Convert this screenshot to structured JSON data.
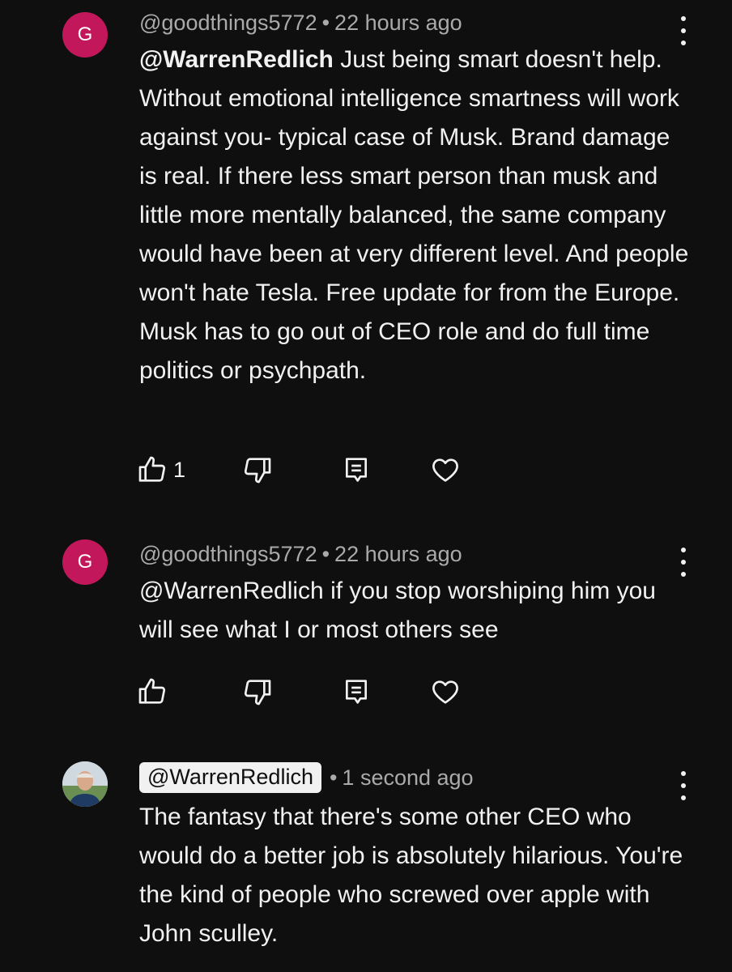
{
  "comments": [
    {
      "avatar_letter": "G",
      "author": "@goodthings5772",
      "separator": "•",
      "time": "22 hours ago",
      "mention": "@WarrenRedlich",
      "text": " Just being smart doesn't help. Without emotional intelligence smartness will work against you- typical case of Musk. Brand damage is real. If there less smart person than musk and little more mentally balanced, the same company would have been at very different level. And people won't hate Tesla. Free update for from the Europe. Musk has to go out of CEO role and do full time politics or psychpath.",
      "likes": "1",
      "icons": [
        "thumbs-up-icon",
        "thumbs-down-icon",
        "reply-icon",
        "heart-icon",
        "more-vert-icon"
      ]
    },
    {
      "avatar_letter": "G",
      "author": "@goodthings5772",
      "separator": "•",
      "time": "22 hours ago",
      "text": "@WarrenRedlich if you stop worshiping him you will see what I or most others see",
      "likes": "",
      "icons": [
        "thumbs-up-icon",
        "thumbs-down-icon",
        "reply-icon",
        "heart-icon",
        "more-vert-icon"
      ]
    },
    {
      "author": "@WarrenRedlich",
      "author_highlighted": true,
      "separator": "•",
      "time": "1 second ago",
      "text": "The fantasy that there's some other CEO who would do a better job is absolutely hilarious. You're the kind of people who screwed over apple with John sculley.",
      "icons": [
        "user-photo-avatar",
        "more-vert-icon"
      ]
    }
  ],
  "colors": {
    "background": "#0f0f0f",
    "text": "#f1f1f1",
    "meta": "#aaaaaa",
    "avatar": "#c2185b"
  }
}
